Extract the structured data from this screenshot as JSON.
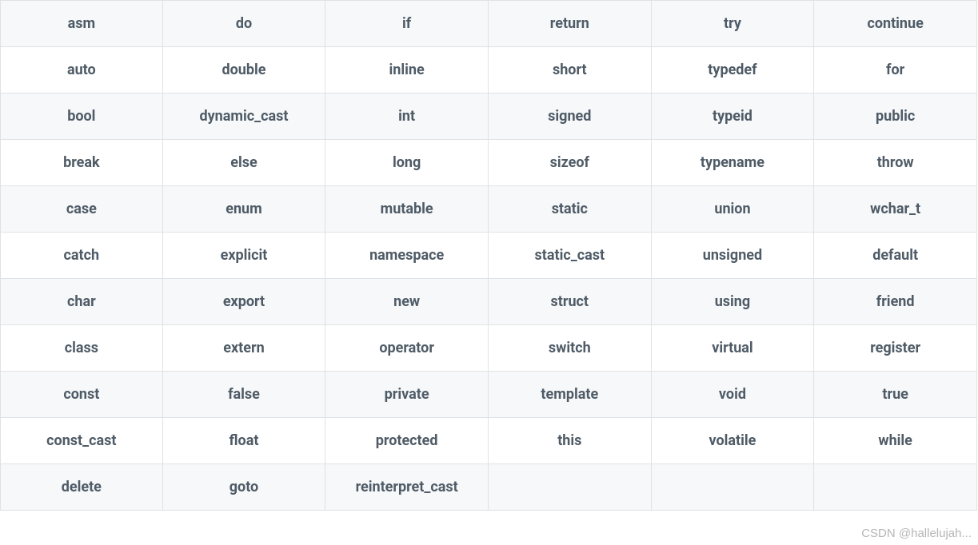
{
  "header": [
    "asm",
    "do",
    "if",
    "return",
    "try",
    "continue"
  ],
  "rows": [
    [
      "auto",
      "double",
      "inline",
      "short",
      "typedef",
      "for"
    ],
    [
      "bool",
      "dynamic_cast",
      "int",
      "signed",
      "typeid",
      "public"
    ],
    [
      "break",
      "else",
      "long",
      "sizeof",
      "typename",
      "throw"
    ],
    [
      "case",
      "enum",
      "mutable",
      "static",
      "union",
      "wchar_t"
    ],
    [
      "catch",
      "explicit",
      "namespace",
      "static_cast",
      "unsigned",
      "default"
    ],
    [
      "char",
      "export",
      "new",
      "struct",
      "using",
      "friend"
    ],
    [
      "class",
      "extern",
      "operator",
      "switch",
      "virtual",
      "register"
    ],
    [
      "const",
      "false",
      "private",
      "template",
      "void",
      "true"
    ],
    [
      "const_cast",
      "float",
      "protected",
      "this",
      "volatile",
      "while"
    ],
    [
      "delete",
      "goto",
      "reinterpret_cast",
      "",
      "",
      ""
    ]
  ],
  "watermark": "CSDN @hallelujah..."
}
